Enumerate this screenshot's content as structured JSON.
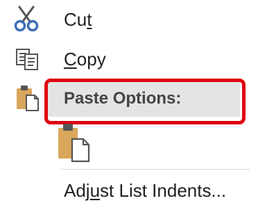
{
  "menu": {
    "cut": {
      "label_prefix": "Cu",
      "label_underline": "t",
      "label_suffix": "",
      "icon": "scissors-icon"
    },
    "copy": {
      "label_prefix": "",
      "label_underline": "C",
      "label_suffix": "opy",
      "icon": "copy-icon"
    },
    "paste_options": {
      "label": "Paste Options:",
      "icon": "clipboard-icon"
    },
    "paste_keep_source": {
      "icon": "clipboard-paste-icon"
    },
    "adjust_list_indents": {
      "label_prefix": "Adj",
      "label_underline": "u",
      "label_suffix": "st List Indents..."
    }
  },
  "colors": {
    "highlight_border": "#e0000f",
    "header_bg": "#e4e4e4",
    "scissors_blue": "#3b6fb5",
    "clipboard_tan": "#d9a65b"
  }
}
